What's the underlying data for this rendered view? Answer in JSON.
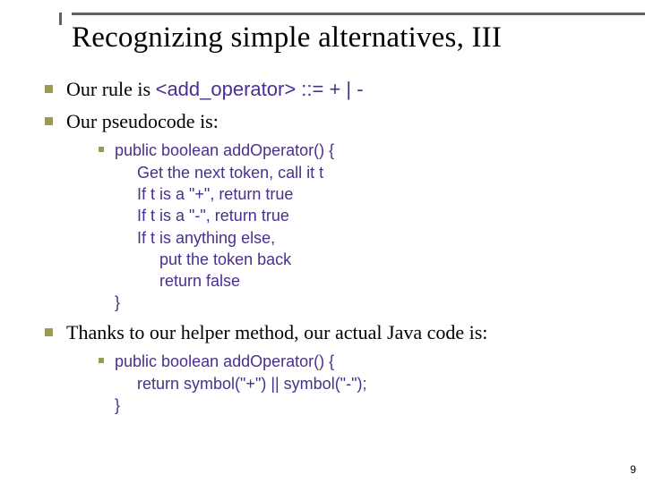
{
  "title": "Recognizing simple alternatives, III",
  "bullets": {
    "rule_prefix": "Our rule is ",
    "rule_code": "<add_operator> ::= + | -",
    "pseudo_intro": "Our pseudocode is:",
    "pseudo_code": "public boolean addOperator() {\n     Get the next token, call it t\n     If t is a \"+\", return true\n     If t is a \"-\", return true\n     If t is anything else,\n          put the token back\n          return false\n}",
    "thanks": "Thanks to our helper method, our actual Java code is:",
    "java_code": "public boolean addOperator() {\n     return symbol(\"+\") || symbol(\"-\");\n}"
  },
  "page_number": "9"
}
